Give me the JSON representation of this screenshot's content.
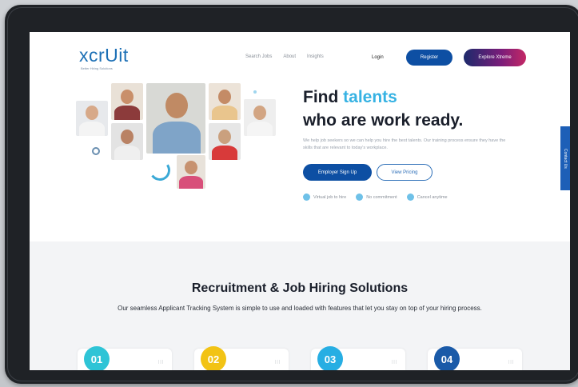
{
  "header": {
    "logo_text": "xcrUit",
    "logo_tagline": "Better Hiring Solutions",
    "nav": [
      "Search Jobs",
      "About",
      "Insights"
    ],
    "login": "Login",
    "register": "Register",
    "explore": "Explore Xtreme"
  },
  "hero": {
    "title_prefix": "Find ",
    "title_accent": "talents",
    "title_line2": "who are work ready.",
    "paragraph": "We help job seekers so we can help you hire the best talents. Our training process ensure they have the skills that are relevant to today's workplace.",
    "signup": "Employer Sign Up",
    "pricing": "View Pricing",
    "features": [
      "Virtual job to hire",
      "No commitment",
      "Cancel anytime"
    ]
  },
  "side_tab": "Contact Us",
  "section": {
    "title": "Recruitment & Job Hiring Solutions",
    "subtitle": "Our seamless Applicant Tracking System is simple to use and loaded with features that let you stay on top of your hiring process.",
    "steps": [
      {
        "num": "01",
        "color": "#2ec4d6"
      },
      {
        "num": "02",
        "color": "#f2c315"
      },
      {
        "num": "03",
        "color": "#27aee3"
      },
      {
        "num": "04",
        "color": "#1a5aa8"
      }
    ]
  },
  "colors": {
    "primary": "#0d4fa3",
    "accent": "#36b2e3",
    "logo": "#1b6fb5"
  }
}
